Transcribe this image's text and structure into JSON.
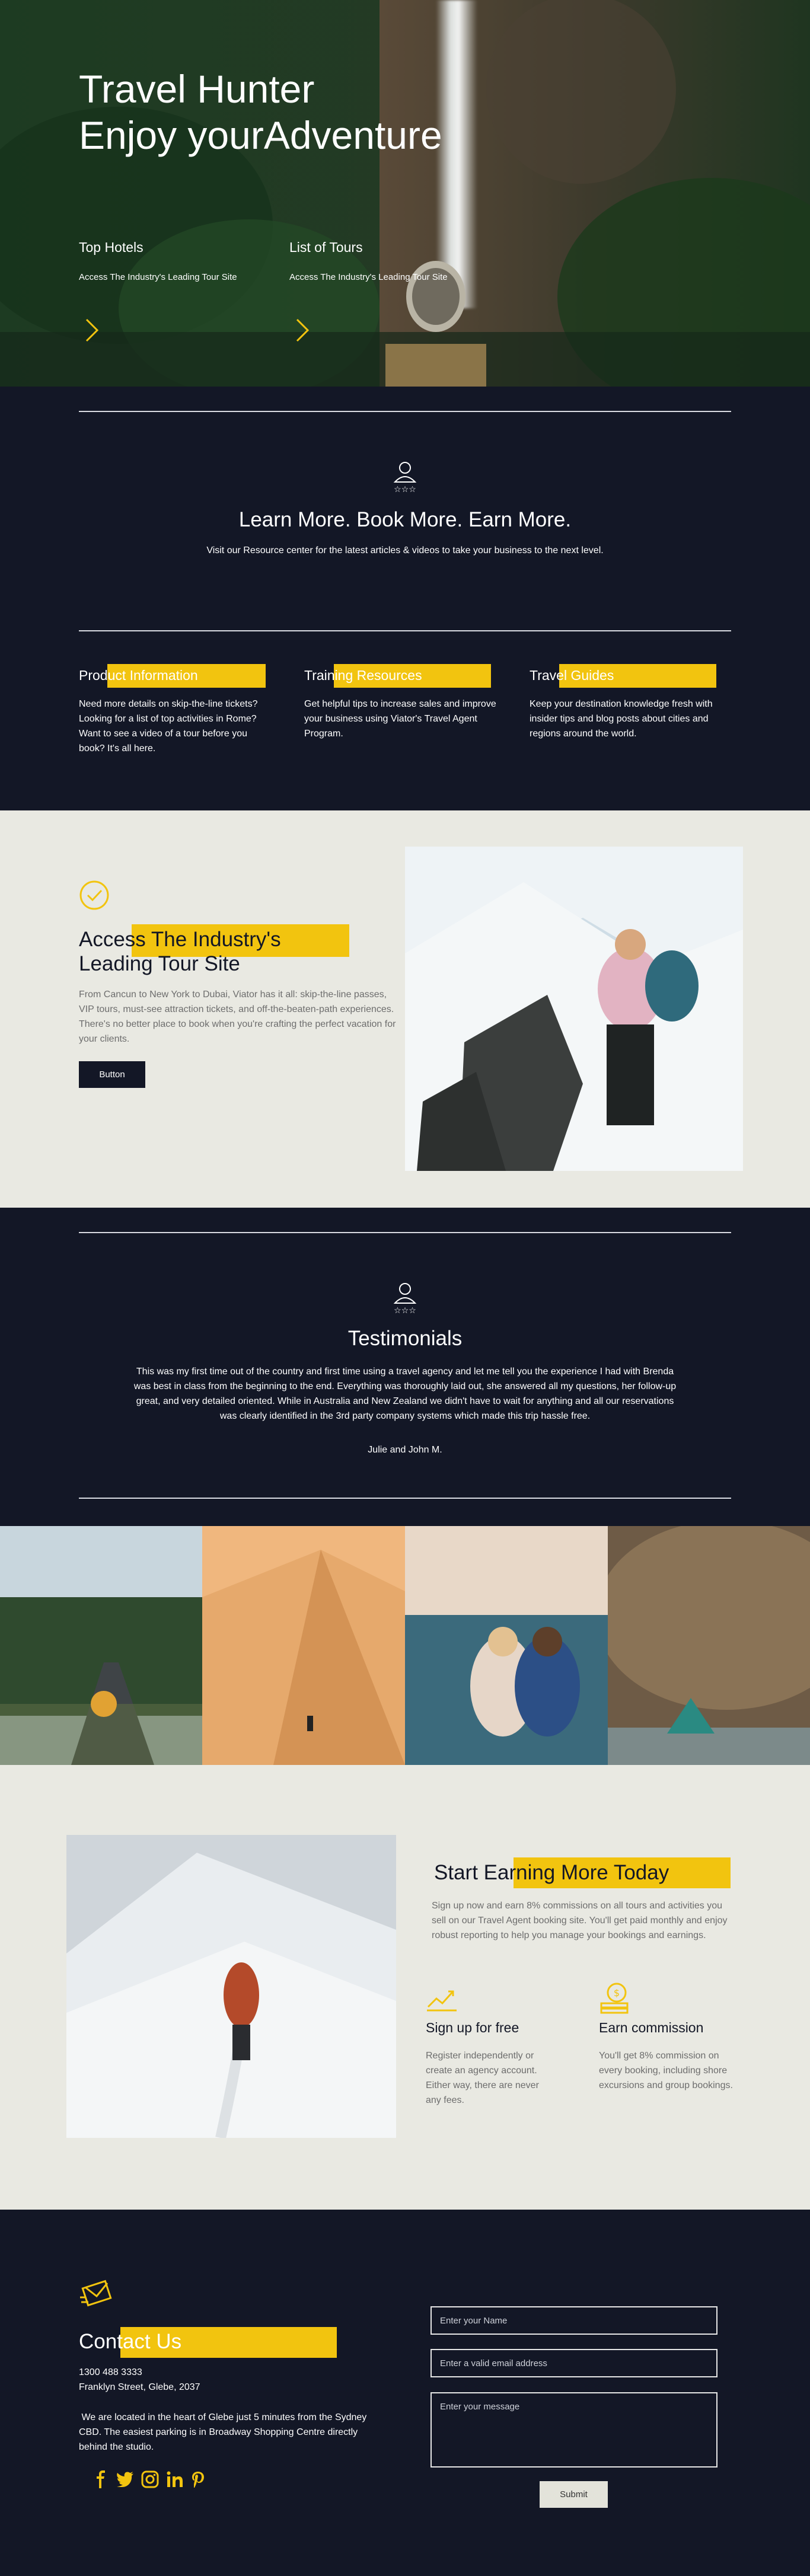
{
  "hero": {
    "title_line1": "Travel Hunter",
    "title_line2": "Enjoy yourAdventure",
    "columns": [
      {
        "title": "Top Hotels",
        "text": "Access The Industry's Leading Tour Site"
      },
      {
        "title": "List of Tours",
        "text": "Access The Industry's Leading Tour Site"
      }
    ]
  },
  "learn": {
    "heading": "Learn More. Book More. Earn More.",
    "subtext": "Visit our Resource center for the latest articles & videos to take your business to the next level.",
    "features": [
      {
        "title": "Product Information",
        "text": "Need more details on skip-the-line tickets? Looking for a list of top activities in Rome? Want to see a video of a tour before you book? It's all here."
      },
      {
        "title": "Training Resources",
        "text": "Get helpful tips to increase sales and improve your business using Viator's Travel Agent Program."
      },
      {
        "title": "Travel Guides",
        "text": "Keep your destination knowledge fresh with insider tips and blog posts about cities and regions around the world."
      }
    ]
  },
  "access": {
    "heading_line1": "Access The Industry's",
    "heading_line2": "Leading Tour Site",
    "text": "From Cancun to New York to Dubai, Viator has it all: skip-the-line passes, VIP tours, must-see attraction tickets, and off-the-beaten-path experiences. There's no better place to book when you're crafting the perfect vacation for your clients.",
    "button_label": "Button"
  },
  "testimonials": {
    "heading": "Testimonials",
    "quote": "This was my first time out of the country and first time using a travel agency and let me tell you the experience I had with Brenda was best in class from the beginning to the end. Everything was thoroughly laid out, she answered all my questions, her follow-up great, and very detailed oriented. While in Australia and New Zealand we didn't have to wait for anything and all our reservations was clearly identified in the 3rd party company systems which made this trip hassle free.",
    "author": "Julie and John M."
  },
  "earning": {
    "heading": "Start Earning More Today",
    "text": "Sign up now and earn 8% commissions on all tours and activities you sell on our Travel Agent booking site. You'll get paid monthly and enjoy robust reporting to help you manage your bookings and earnings.",
    "items": [
      {
        "title": "Sign up for free",
        "text": "Register independently or create an agency account. Either way, there are never any fees."
      },
      {
        "title": "Earn commission",
        "text": "You'll get 8% commission on every booking, including shore excursions and group bookings."
      }
    ]
  },
  "contact": {
    "heading": "Contact Us",
    "phone": "1300 488 3333",
    "address": "Franklyn Street, Glebe, 2037",
    "location_text": " We are located in the heart of Glebe just 5 minutes from the Sydney CBD. The easiest parking is in Broadway Shopping Centre directly behind the studio.",
    "name_placeholder": "Enter your Name",
    "email_placeholder": "Enter a valid email address",
    "message_placeholder": "Enter your message",
    "submit_label": "Submit"
  },
  "colors": {
    "accent": "#f2c40f",
    "navy": "#131726",
    "cream": "#e9e9e2"
  }
}
